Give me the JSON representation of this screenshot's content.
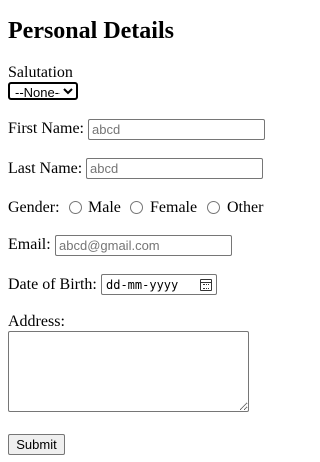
{
  "form": {
    "title": "Personal Details",
    "salutation": {
      "label": "Salutation",
      "selected": "--None--"
    },
    "first_name": {
      "label": "First Name:",
      "placeholder": "abcd"
    },
    "last_name": {
      "label": "Last Name:",
      "placeholder": "abcd"
    },
    "gender": {
      "label": "Gender:",
      "options": [
        "Male",
        "Female",
        "Other"
      ]
    },
    "email": {
      "label": "Email:",
      "placeholder": "abcd@gmail.com"
    },
    "dob": {
      "label": "Date of Birth:",
      "placeholder": "dd-mm-yyyy",
      "icon": "calendar-icon"
    },
    "address": {
      "label": "Address:",
      "value": ""
    },
    "submit_label": "Submit"
  }
}
